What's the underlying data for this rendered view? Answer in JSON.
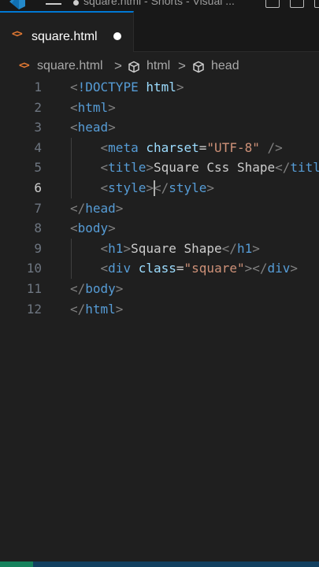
{
  "window": {
    "title": "square.html - Shorts - Visual ..."
  },
  "tab": {
    "label": "square.html",
    "file_icon": "<>"
  },
  "breadcrumb": {
    "file_icon": "<>",
    "items": [
      "square.html",
      "html",
      "head"
    ],
    "separator": ">"
  },
  "editor": {
    "active_line": 6,
    "lines": [
      {
        "num": "1",
        "tokens": [
          [
            "t-bracket",
            "<"
          ],
          [
            "t-tag",
            "!DOCTYPE"
          ],
          [
            "t-text",
            " "
          ],
          [
            "t-attr",
            "html"
          ],
          [
            "t-bracket",
            ">"
          ]
        ]
      },
      {
        "num": "2",
        "tokens": [
          [
            "t-bracket",
            "<"
          ],
          [
            "t-tag",
            "html"
          ],
          [
            "t-bracket",
            ">"
          ]
        ]
      },
      {
        "num": "3",
        "tokens": [
          [
            "t-bracket",
            "<"
          ],
          [
            "t-tag",
            "head"
          ],
          [
            "t-bracket",
            ">"
          ]
        ]
      },
      {
        "num": "4",
        "tokens": [
          [
            "t-text",
            "    "
          ],
          [
            "t-bracket",
            "<"
          ],
          [
            "t-tag",
            "meta"
          ],
          [
            "t-text",
            " "
          ],
          [
            "t-attr",
            "charset"
          ],
          [
            "t-eq",
            "="
          ],
          [
            "t-str",
            "\"UTF-8\""
          ],
          [
            "t-text",
            " "
          ],
          [
            "t-bracket",
            "/>"
          ]
        ]
      },
      {
        "num": "5",
        "tokens": [
          [
            "t-text",
            "    "
          ],
          [
            "t-bracket",
            "<"
          ],
          [
            "t-tag",
            "title"
          ],
          [
            "t-bracket",
            ">"
          ],
          [
            "t-text",
            "Square Css Shape"
          ],
          [
            "t-bracket",
            "</"
          ],
          [
            "t-tag",
            "title"
          ],
          [
            "t-bracket",
            ">"
          ]
        ]
      },
      {
        "num": "6",
        "tokens": [
          [
            "t-text",
            "    "
          ],
          [
            "t-bracket",
            "<"
          ],
          [
            "t-tag",
            "style"
          ],
          [
            "t-bracket",
            ">"
          ],
          [
            "t-bracket",
            "</"
          ],
          [
            "t-tag",
            "style"
          ],
          [
            "t-bracket",
            ">"
          ]
        ]
      },
      {
        "num": "7",
        "tokens": [
          [
            "t-bracket",
            "</"
          ],
          [
            "t-tag",
            "head"
          ],
          [
            "t-bracket",
            ">"
          ]
        ]
      },
      {
        "num": "8",
        "tokens": [
          [
            "t-bracket",
            "<"
          ],
          [
            "t-tag",
            "body"
          ],
          [
            "t-bracket",
            ">"
          ]
        ]
      },
      {
        "num": "9",
        "tokens": [
          [
            "t-text",
            "    "
          ],
          [
            "t-bracket",
            "<"
          ],
          [
            "t-tag",
            "h1"
          ],
          [
            "t-bracket",
            ">"
          ],
          [
            "t-text",
            "Square Shape"
          ],
          [
            "t-bracket",
            "</"
          ],
          [
            "t-tag",
            "h1"
          ],
          [
            "t-bracket",
            ">"
          ]
        ]
      },
      {
        "num": "10",
        "tokens": [
          [
            "t-text",
            "    "
          ],
          [
            "t-bracket",
            "<"
          ],
          [
            "t-tag",
            "div"
          ],
          [
            "t-text",
            " "
          ],
          [
            "t-attr",
            "class"
          ],
          [
            "t-eq",
            "="
          ],
          [
            "t-str",
            "\"square\""
          ],
          [
            "t-bracket",
            ">"
          ],
          [
            "t-bracket",
            "</"
          ],
          [
            "t-tag",
            "div"
          ],
          [
            "t-bracket",
            ">"
          ]
        ]
      },
      {
        "num": "11",
        "tokens": [
          [
            "t-bracket",
            "</"
          ],
          [
            "t-tag",
            "body"
          ],
          [
            "t-bracket",
            ">"
          ]
        ]
      },
      {
        "num": "12",
        "tokens": [
          [
            "t-bracket",
            "</"
          ],
          [
            "t-tag",
            "html"
          ],
          [
            "t-bracket",
            ">"
          ]
        ]
      }
    ]
  },
  "icons": {
    "app": "vscode-logo-icon",
    "menu": "hamburger-menu-icon",
    "file": "html-file-icon",
    "symbol": "cube-symbol-icon",
    "dirty": "unsaved-dot-icon",
    "layout": "layout-toggle-icon"
  },
  "colors": {
    "background": "#1f1f1f",
    "tag": "#569cd6",
    "attribute": "#9cdcfe",
    "string": "#ce9178",
    "punctuation": "#808080",
    "file_icon": "#e37933",
    "accent": "#0078d4"
  }
}
